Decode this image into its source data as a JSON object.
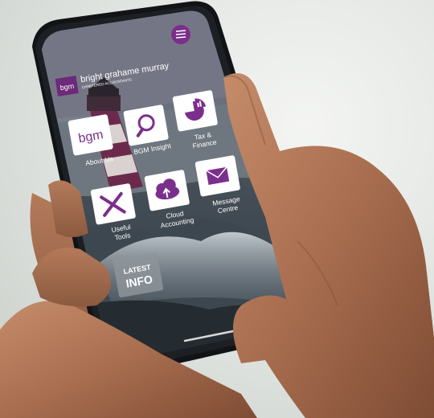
{
  "app": {
    "brand_name": "bright grahame murray",
    "brand_sub": "CHARTERED ACCOUNTANTS",
    "logo_text": "bgm",
    "menu_icon": "hamburger-icon",
    "accent_color": "#6b2a7a"
  },
  "tiles": [
    {
      "id": "about-us",
      "label_lines": [
        "About Us"
      ],
      "icon": "bgm-logo-icon"
    },
    {
      "id": "bgm-insight",
      "label_lines": [
        "BGM Insight"
      ],
      "icon": "magnifier-icon"
    },
    {
      "id": "tax-finance",
      "label_lines": [
        "Tax &",
        "Finance"
      ],
      "icon": "pie-chart-icon"
    },
    {
      "id": "useful-tools",
      "label_lines": [
        "Useful",
        "Tools"
      ],
      "icon": "tools-icon"
    },
    {
      "id": "cloud-accounting",
      "label_lines": [
        "Cloud",
        "Accounting"
      ],
      "icon": "cloud-upload-icon"
    },
    {
      "id": "message-centre",
      "label_lines": [
        "Message",
        "Centre"
      ],
      "icon": "envelope-icon"
    }
  ],
  "latest": {
    "line1": "LATEST",
    "line2": "INFO"
  }
}
